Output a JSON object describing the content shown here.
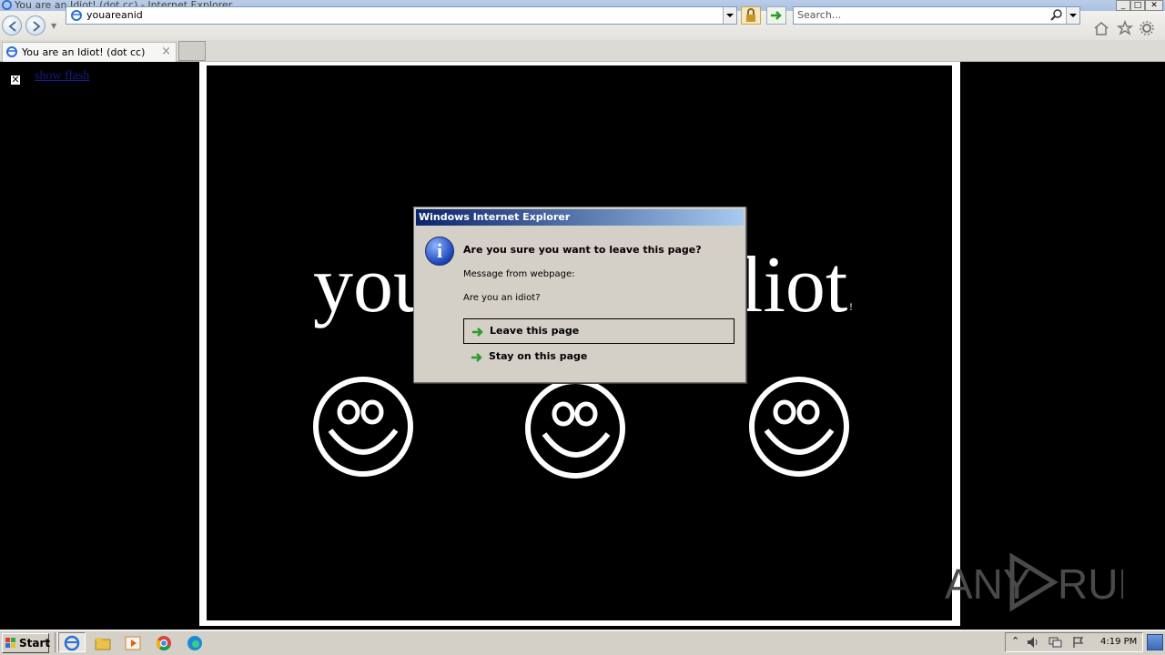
{
  "window": {
    "title": "You are an Idiot! (dot cc) - Internet Explorer"
  },
  "navbar": {
    "address": "youareanid",
    "search_placeholder": "Search..."
  },
  "tabs": [
    {
      "label": "You are an Idiot! (dot cc)"
    }
  ],
  "page": {
    "flash_link": "show flash",
    "big_text_left": "you",
    "big_text_right": "liot",
    "exclaim": "!"
  },
  "dialog": {
    "title": "Windows Internet Explorer",
    "heading": "Are you sure you want to leave this page?",
    "message_label": "Message from webpage:",
    "message": "Are you an idiot?",
    "leave_label": "Leave this page",
    "stay_label": "Stay on this page"
  },
  "taskbar": {
    "start_label": "Start",
    "clock": "4:19 PM"
  },
  "watermark": {
    "text_left": "ANY",
    "text_right": "RUN"
  },
  "colors": {
    "dialog_title_start": "#0a246a",
    "dialog_title_end": "#a6caf0",
    "arrow_green": "#2e9a2e"
  }
}
